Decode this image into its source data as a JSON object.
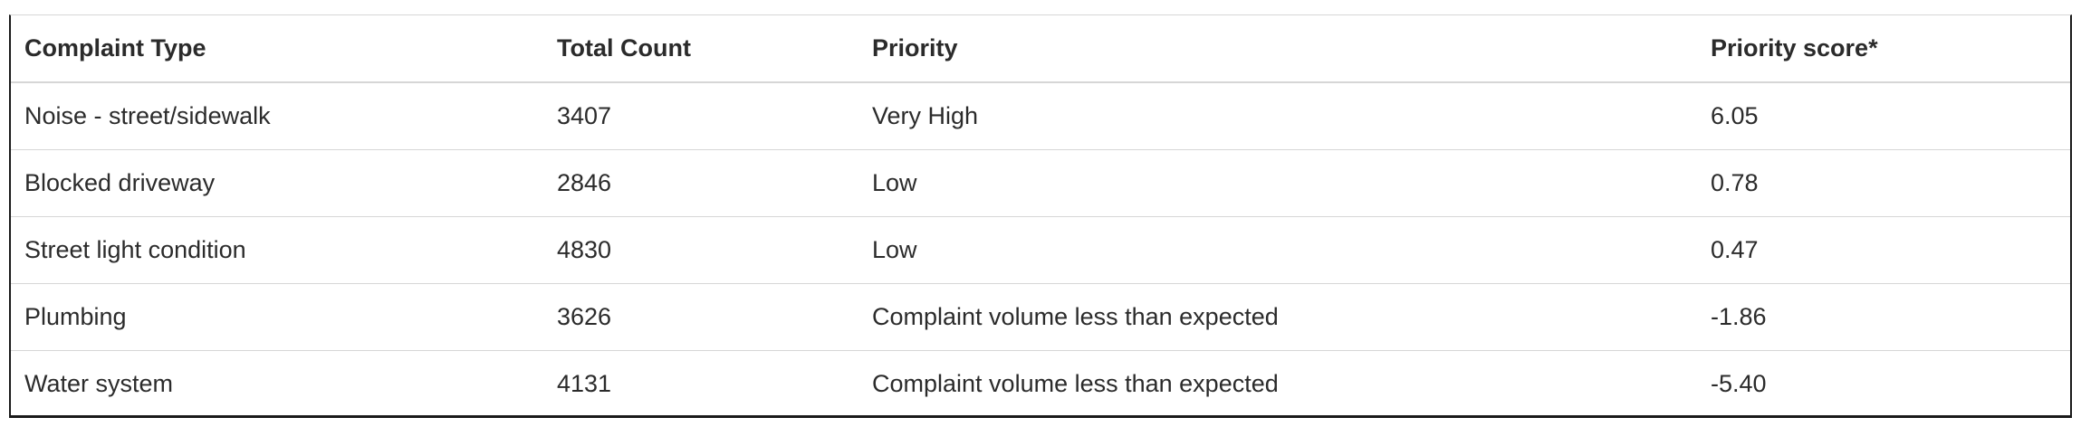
{
  "table": {
    "headers": [
      "Complaint Type",
      "Total Count",
      "Priority",
      "Priority score*"
    ],
    "rows": [
      [
        "Noise - street/sidewalk",
        "3407",
        "Very High",
        "6.05"
      ],
      [
        "Blocked driveway",
        "2846",
        "Low",
        "0.78"
      ],
      [
        "Street light condition",
        "4830",
        "Low",
        "0.47"
      ],
      [
        "Plumbing",
        "3626",
        "Complaint volume less than expected",
        "-1.86"
      ],
      [
        "Water system",
        "4131",
        "Complaint volume less than expected",
        "-5.40"
      ]
    ]
  },
  "colors": {
    "border_dark": "#1a1a1a",
    "row_divider": "#d6d6d6",
    "text": "#2b2b2b"
  }
}
